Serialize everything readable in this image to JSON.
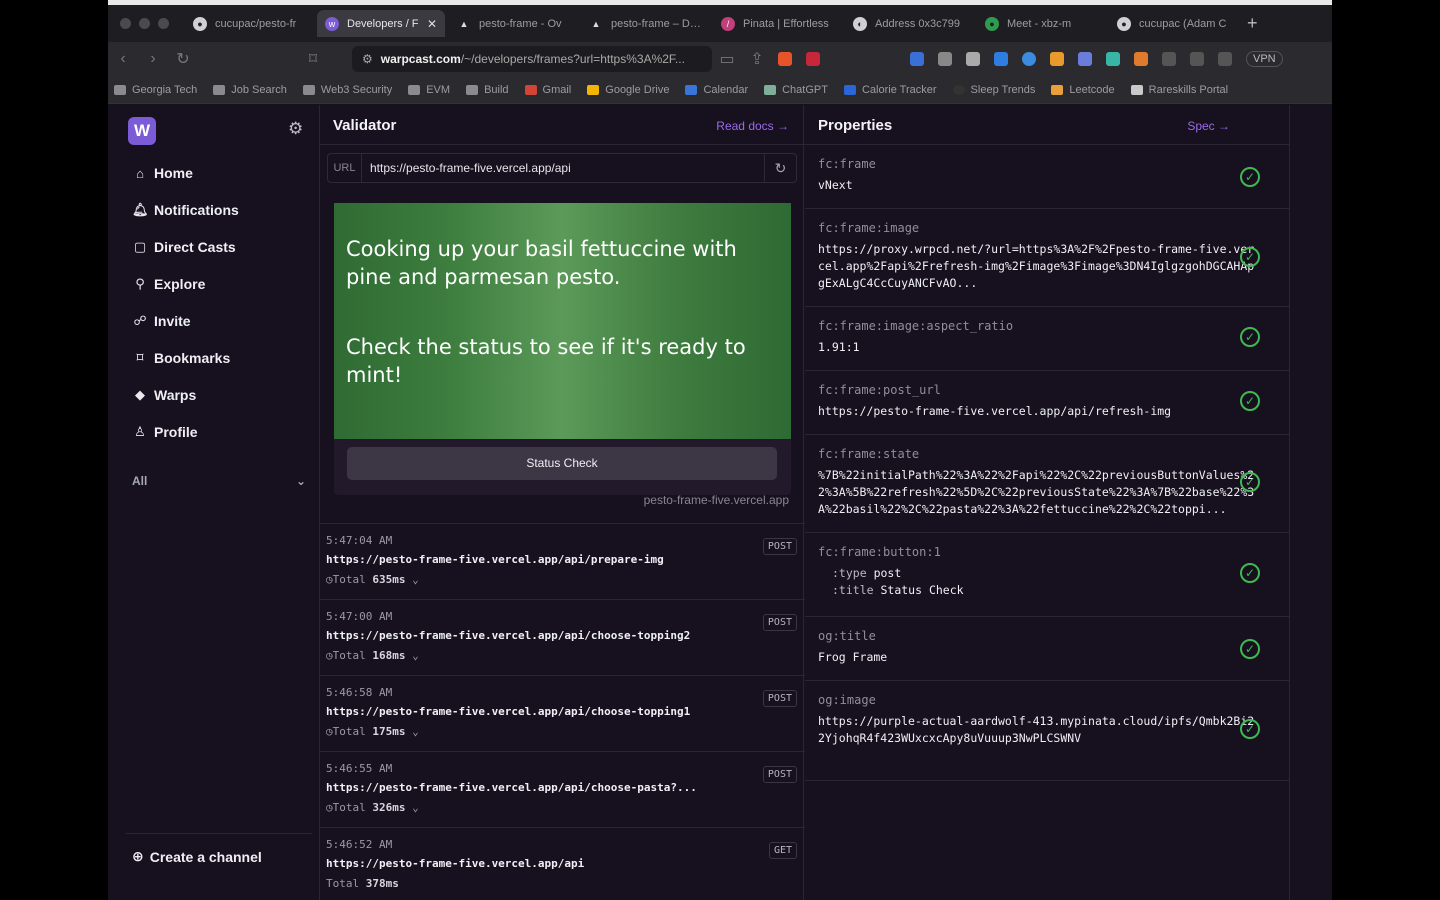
{
  "browser": {
    "tabs": [
      {
        "label": "cucupac/pesto-fr",
        "icon": "github-icon"
      },
      {
        "label": "Developers / F",
        "icon": "warpcast-icon",
        "active": true
      },
      {
        "label": "pesto-frame - Ov",
        "icon": "vercel-icon"
      },
      {
        "label": "pesto-frame – Dep",
        "icon": "vercel-icon"
      },
      {
        "label": "Pinata | Effortless",
        "icon": "pinata-icon"
      },
      {
        "label": "Address 0x3c799",
        "icon": "etherscan-icon"
      },
      {
        "label": "Meet - xbz-m",
        "icon": "meet-icon"
      },
      {
        "label": "cucupac (Adam C",
        "icon": "github-icon"
      }
    ],
    "url_domain": "warpcast.com",
    "url_path": "/~/developers/frames?url=https%3A%2F...",
    "vpn_label": "VPN",
    "bookmarks": [
      "Georgia Tech",
      "Job Search",
      "Web3 Security",
      "EVM",
      "Build",
      "Gmail",
      "Google Drive",
      "Calendar",
      "ChatGPT",
      "Calorie Tracker",
      "Sleep Trends",
      "Leetcode",
      "Rareskills Portal"
    ]
  },
  "sidebar": {
    "logo": "W",
    "items": [
      {
        "label": "Home",
        "icon": "house-icon"
      },
      {
        "label": "Notifications",
        "icon": "bell-icon"
      },
      {
        "label": "Direct Casts",
        "icon": "chat-icon"
      },
      {
        "label": "Explore",
        "icon": "search-icon"
      },
      {
        "label": "Invite",
        "icon": "invite-icon"
      },
      {
        "label": "Bookmarks",
        "icon": "bookmark-icon"
      },
      {
        "label": "Warps",
        "icon": "diamond-icon"
      },
      {
        "label": "Profile",
        "icon": "person-icon"
      }
    ],
    "filter": "All",
    "create_channel": "Create a channel"
  },
  "validator": {
    "title": "Validator",
    "read_docs": "Read docs →",
    "url_prefix": "URL",
    "url_value": "https://pesto-frame-five.vercel.app/api",
    "frame_text_1": "Cooking up your basil fettuccine with pine and parmesan pesto.",
    "frame_text_2": "Check the status to see if it's ready to mint!",
    "frame_button": "Status Check",
    "frame_host": "pesto-frame-five.vercel.app",
    "log": [
      {
        "time": "5:47:04 AM",
        "url": "https://pesto-frame-five.vercel.app/api/prepare-img",
        "total_label": "Total",
        "total": "635ms",
        "method": "POST"
      },
      {
        "time": "5:47:00 AM",
        "url": "https://pesto-frame-five.vercel.app/api/choose-topping2",
        "total_label": "Total",
        "total": "168ms",
        "method": "POST"
      },
      {
        "time": "5:46:58 AM",
        "url": "https://pesto-frame-five.vercel.app/api/choose-topping1",
        "total_label": "Total",
        "total": "175ms",
        "method": "POST"
      },
      {
        "time": "5:46:55 AM",
        "url": "https://pesto-frame-five.vercel.app/api/choose-pasta?...",
        "total_label": "Total",
        "total": "326ms",
        "method": "POST"
      },
      {
        "time": "5:46:52 AM",
        "url": "https://pesto-frame-five.vercel.app/api",
        "total_label": "Total",
        "total": "378ms",
        "method": "GET"
      }
    ]
  },
  "properties": {
    "title": "Properties",
    "spec": "Spec →",
    "items": [
      {
        "key": "fc:frame",
        "value": "vNext",
        "status": "valid"
      },
      {
        "key": "fc:frame:image",
        "value": "https://proxy.wrpcd.net/?url=https%3A%2F%2Fpesto-frame-five.vercel.app%2Fapi%2Frefresh-img%2Fimage%3Fimage%3DN4IglgzgohDGCAHApgExALgC4CcCuyANCFvAO...",
        "status": "valid"
      },
      {
        "key": "fc:frame:image:aspect_ratio",
        "value": "1.91:1",
        "status": "valid"
      },
      {
        "key": "fc:frame:post_url",
        "value": "https://pesto-frame-five.vercel.app/api/refresh-img",
        "status": "valid"
      },
      {
        "key": "fc:frame:state",
        "value": "%7B%22initialPath%22%3A%22%2Fapi%22%2C%22previousButtonValues%22%3A%5B%22refresh%22%5D%2C%22previousState%22%3A%7B%22base%22%3A%22basil%22%2C%22pasta%22%3A%22fettuccine%22%2C%22toppi...",
        "status": "valid"
      },
      {
        "key": "fc:frame:button:1",
        "type_label": ":type",
        "type_value": "post",
        "title_label": ":title",
        "title_value": "Status Check",
        "status": "valid"
      },
      {
        "key": "og:title",
        "value": "Frog Frame",
        "status": "valid"
      },
      {
        "key": "og:image",
        "value": "https://purple-actual-aardwolf-413.mypinata.cloud/ipfs/Qmbk2Bi22YjohqR4f423WUxcxcApy8uVuuup3NwPLCSWNV",
        "status": "valid"
      }
    ]
  },
  "colors": {
    "accent": "#9a6ae8",
    "valid": "#3fb950",
    "frame_green": "#4a8a48"
  }
}
